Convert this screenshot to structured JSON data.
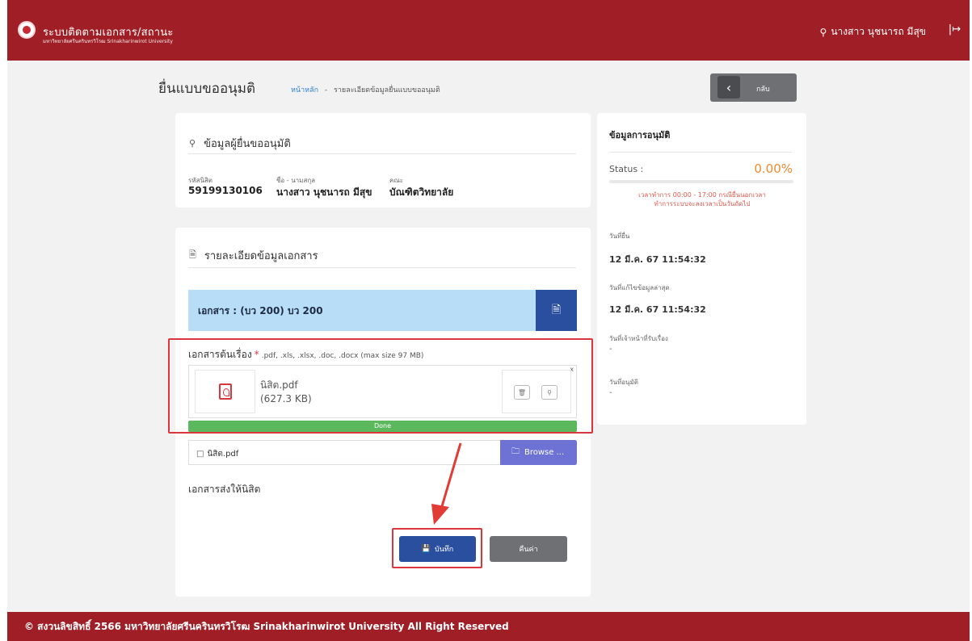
{
  "header": {
    "app_title": "ระบบติดตามเอกสาร/สถานะ",
    "app_subtitle": "มหาวิทยาลัยศรีนครินทรวิโรฒ Srinakharinwirot University",
    "user_name": "นางสาว นุชนารถ มีสุข",
    "user_icon": "user-icon",
    "logout_icon": "logout-icon"
  },
  "page": {
    "title": "ยื่นแบบขออนุมติ",
    "breadcrumb_home": "หน้าหลัก",
    "breadcrumb_sep": "-",
    "breadcrumb_current": "รายละเอียดข้อมูลยื่นแบบขออนุมติ",
    "back_label": "กลับ"
  },
  "applicant": {
    "heading": "ข้อมูลผู้ยื่นขออนุมัติ",
    "student_id_label": "รหัสนิสิต",
    "student_id": "59199130106",
    "name_label": "ชื่อ - นามสกุล",
    "name": "นางสาว นุชนารถ มีสุข",
    "faculty_label": "คณะ",
    "faculty": "บัณฑิตวิทยาลัย"
  },
  "document": {
    "heading": "รายละเอียดข้อมูลเอกสาร",
    "doc_title": "เอกสาร : (บว 200) บว 200",
    "upload_label": "เอกสารต้นเรื่อง",
    "required_mark": "*",
    "upload_hint": ".pdf, .xls, .xlsx, .doc, .docx (max size 97 MB)",
    "close_mark": "x",
    "file_name": "นิสิต.pdf",
    "file_size": "(627.3 KB)",
    "progress_label": "Done",
    "progress_fraction": 1.0,
    "browse_file_name": "นิสิต.pdf",
    "browse_label": "Browse ...",
    "sent_label": "เอกสารส่งให้นิสิต",
    "save_label": "บันทึก",
    "reset_label": "คืนค่า"
  },
  "approval": {
    "heading": "ข้อมูลการอนุมัติ",
    "status_label": "Status :",
    "status_value": "0.00%",
    "status_fraction": 0.0,
    "note_line1": "เวลาทำการ 00:00 - 17:00 กรณียื่นนอกเวลา",
    "note_line2": "ทำการระบบจะลงเวลาเป็นวันถัดไป",
    "submitted_label": "วันที่ยื่น",
    "submitted_value": "12 มี.ค. 67 11:54:32",
    "updated_label": "วันที่แก้ไขข้อมูลล่าสุด",
    "updated_value": "12 มี.ค. 67 11:54:32",
    "received_label": "วันที่เจ้าหน้าที่รับเรื่อง",
    "received_value": "-",
    "approved_label": "วันที่อนุมัติ",
    "approved_value": "-"
  },
  "footer": {
    "text": "© สงวนลิขสิทธิ์ 2566 มหาวิทยาลัยศรีนครินทรวิโรฒ Srinakharinwirot University All Right Reserved"
  },
  "colors": {
    "brand": "#a01f27",
    "primary_button": "#2a4f9e",
    "browse_button": "#6d72d4",
    "success": "#5cb85c",
    "status_accent": "#ef8a2f",
    "annotation_red": "#d9363e"
  }
}
